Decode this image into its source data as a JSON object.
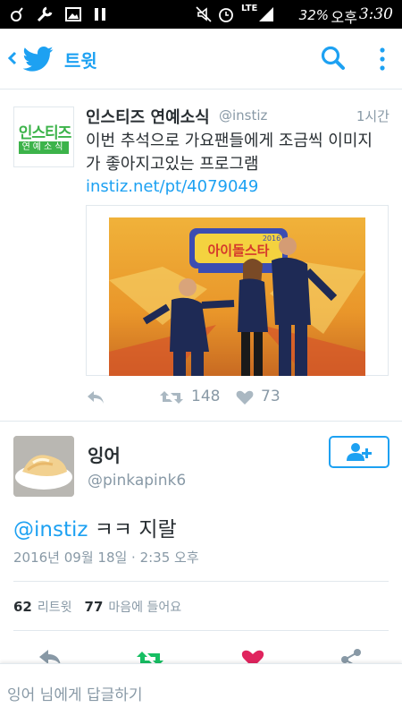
{
  "status_bar": {
    "battery": "32%",
    "ampm": "오후",
    "time": "3:30",
    "network": "LTE"
  },
  "header": {
    "title": "트윗",
    "accent": "#1da1f2"
  },
  "quoted_tweet": {
    "logo_top": "인스티즈",
    "logo_bottom": "연예소식",
    "name": "인스티즈 연예소식",
    "handle": "@instiz",
    "time": "1시간",
    "text": "이번 추석으로 가요팬들에게 조금씩 이미지가 좋아지고있는 프로그램",
    "link": "instiz.net/pt/4079049",
    "photo_caption": "아이돌스타",
    "photo_sub": "2016",
    "retweet_count": "148",
    "like_count": "73"
  },
  "main_tweet": {
    "name": "잉어",
    "handle": "@pinkapink6",
    "mention": "@instiz",
    "text": " ㅋㅋ 지랄",
    "timestamp": "2016년 09월 18일 · 2:35 오후",
    "retweets": "62",
    "retweets_label": "리트윗",
    "likes": "77",
    "likes_label": "마음에 들어요"
  },
  "reply_bar": {
    "placeholder": "잉어 님에게 답글하기"
  },
  "icons": [
    "back-icon",
    "twitter-bird-icon",
    "search-icon",
    "more-vertical-icon",
    "reply-icon",
    "retweet-icon",
    "heart-icon",
    "follow-user-icon",
    "share-icon"
  ]
}
